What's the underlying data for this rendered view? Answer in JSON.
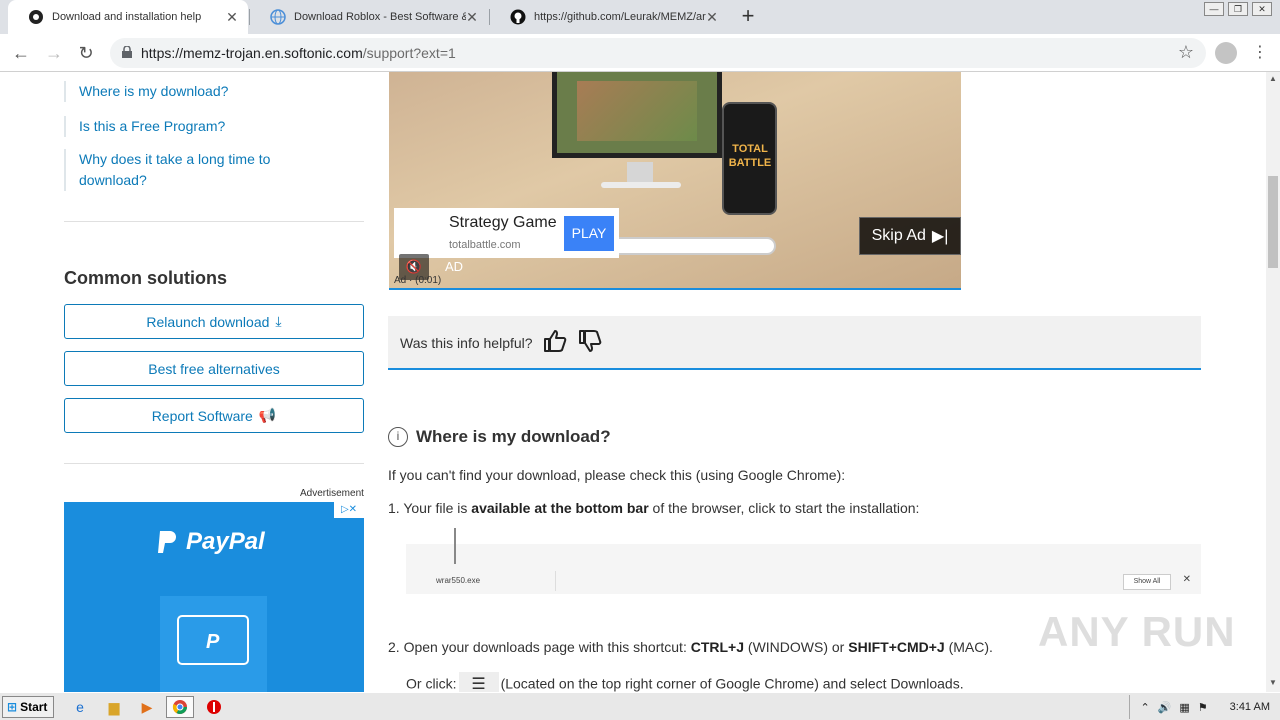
{
  "tabs": [
    {
      "title": "Download and installation help",
      "icon": "softonic-icon"
    },
    {
      "title": "Download Roblox - Best Software &",
      "icon": "globe-icon"
    },
    {
      "title": "https://github.com/Leurak/MEMZ/ar",
      "icon": "github-icon"
    }
  ],
  "address": {
    "host": "https://memz-trojan.en.softonic.com",
    "path": "/support?ext=1"
  },
  "sidebar": {
    "faq": [
      "Where is my download?",
      "Is this a Free Program?",
      "Why does it take a long time to download?"
    ],
    "common_title": "Common solutions",
    "buttons": [
      "Relaunch download",
      "Best free alternatives",
      "Report Software"
    ],
    "advertisement_label": "Advertisement",
    "paypal_brand": "PayPal"
  },
  "video_ad": {
    "card_title": "Strategy Game",
    "card_domain": "totalbattle.com",
    "play_label": "PLAY",
    "skip_label": "Skip Ad",
    "ad_tag": "AD",
    "timer": "Ad · (0:01)",
    "game_logo": "TOTAL BATTLE"
  },
  "helpful": {
    "question": "Was this info helpful?"
  },
  "main": {
    "heading": "Where is my download?",
    "intro": "If you can't find your download, please check this (using Google Chrome):",
    "step1_pre": "1. Your file is ",
    "step1_bold": "available at the bottom bar",
    "step1_post": " of the browser, click to start the installation:",
    "dl_file": "wrar550.exe",
    "dl_showall": "Show All",
    "step2_pre": "2. Open your downloads page with this shortcut: ",
    "step2_k1": "CTRL+J",
    "step2_mid": " (WINDOWS) or ",
    "step2_k2": "SHIFT+CMD+J",
    "step2_post": " (MAC).",
    "step2b_pre": "Or click:",
    "step2b_post": "(Located on the top right corner of Google Chrome) and select Downloads."
  },
  "watermark": "ANY RUN",
  "taskbar": {
    "start": "Start",
    "time": "3:41 AM"
  },
  "colors": {
    "link": "#0c7ab8",
    "accent": "#1a8ddd",
    "play": "#3a82f7"
  }
}
